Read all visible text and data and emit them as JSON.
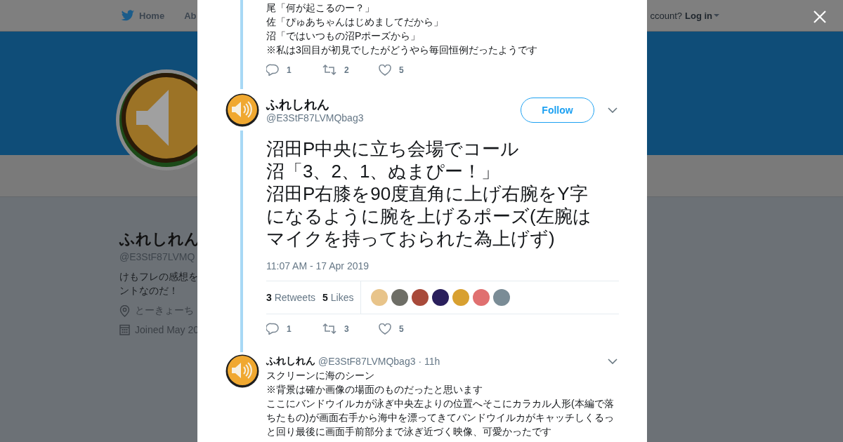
{
  "nav": {
    "items": [
      {
        "label": "Home",
        "kind": "home"
      },
      {
        "label": "Ab",
        "kind": "plain"
      }
    ],
    "account_prompt": "ccount?",
    "login": "Log in"
  },
  "profile": {
    "name": "ふれしれん",
    "handle": "@E3StF87LVMQ",
    "bio": [
      "けもフレの感想を",
      "ントなのだ！"
    ],
    "location": "とーきょーち",
    "joined": "Joined May 20"
  },
  "thread": {
    "previous_tweet": {
      "lines": [
        "尾「何が起こるのー？」",
        "佐「ぴゅあちゃんはじめましてだから」",
        "沼「ではいつもの沼Pポーズから」",
        "※私は3回目が初見でしたがどうやら毎回恒例だったようです"
      ],
      "actions": [
        {
          "kind": "reply",
          "count": "1"
        },
        {
          "kind": "retweet",
          "count": "2"
        },
        {
          "kind": "like",
          "count": "5"
        }
      ]
    },
    "main_tweet": {
      "name": "ふれしれん",
      "handle": "@E3StF87LVMQbag3",
      "follow": "Follow",
      "lines": [
        "沼田P中央に立ち会場でコール",
        "沼「3、2、1、ぬまぴー！」",
        "沼田P右膝を90度直角に上げ右腕をY字",
        "になるように腕を上げるポーズ(左腕は",
        "マイクを持っておられた為上げず)"
      ],
      "timestamp": "11:07 AM - 17 Apr 2019",
      "stats": [
        {
          "count": "3",
          "label": "Retweets"
        },
        {
          "count": "5",
          "label": "Likes"
        }
      ],
      "likers": [
        {
          "color": "#e8c48a"
        },
        {
          "color": "#6e6e66"
        },
        {
          "color": "#a84a3a"
        },
        {
          "color": "#2a1f5c"
        },
        {
          "color": "#d8a030"
        },
        {
          "color": "#e07070"
        },
        {
          "color": "#7a8c96"
        }
      ],
      "actions": [
        {
          "kind": "reply",
          "count": "1"
        },
        {
          "kind": "retweet",
          "count": "3"
        },
        {
          "kind": "like",
          "count": "5"
        }
      ]
    },
    "reply_tweet": {
      "name": "ふれしれん",
      "handle": "@E3StF87LVMQbag3",
      "time": "· 11h",
      "lines": [
        "スクリーンに海のシーン",
        "※背景は確か画像の場面のものだったと思います",
        "ここにバンドウイルカが泳ぎ中央左よりの位置へそこにカラカル人形(本編で落",
        "ちたもの)が画面右手から海中を漂ってきてバンドウイルカがキャッチしくるっ",
        "と回り最後に画面手前部分まで泳ぎ近づく映像、可愛かったです"
      ]
    }
  }
}
